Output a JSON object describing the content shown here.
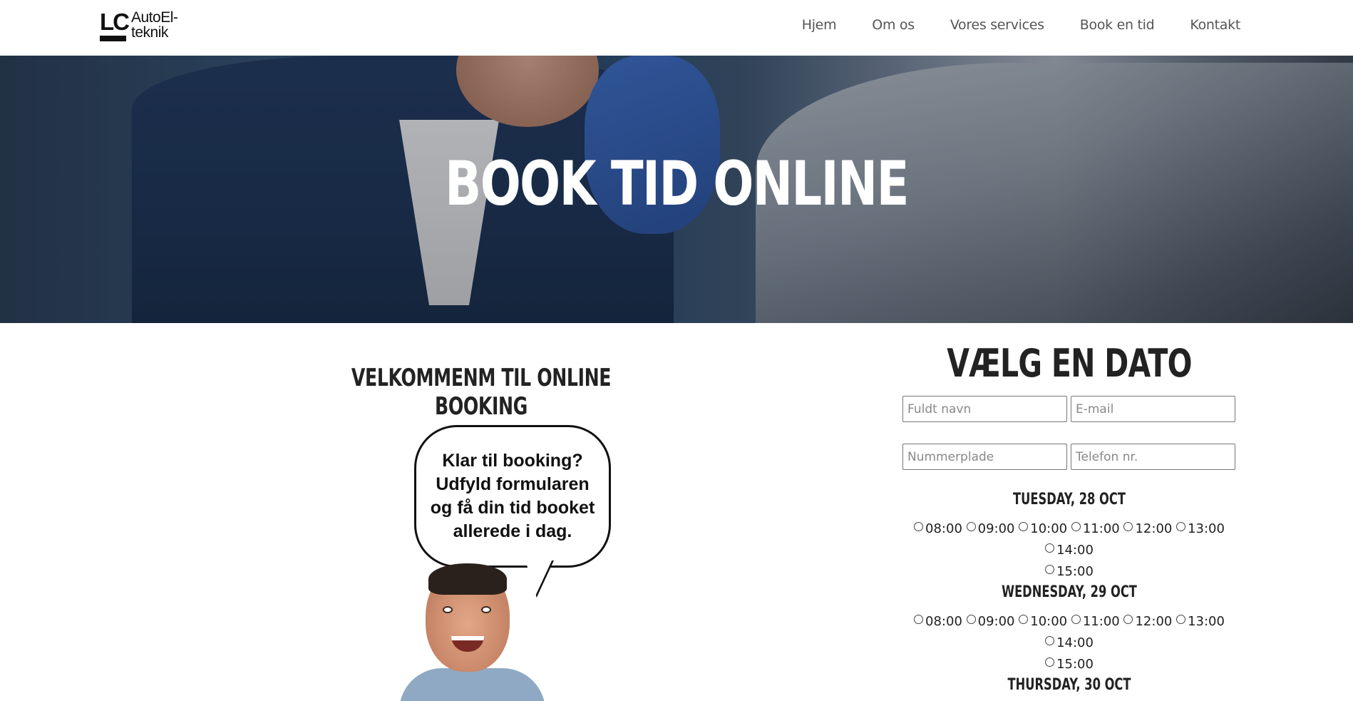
{
  "header": {
    "logo": {
      "mark": "LC",
      "text_line1": "AutoEl-",
      "text_line2": "teknik"
    },
    "nav": [
      {
        "label": "Hjem"
      },
      {
        "label": "Om os"
      },
      {
        "label": "Vores services"
      },
      {
        "label": "Book en tid"
      },
      {
        "label": "Kontakt"
      }
    ]
  },
  "hero": {
    "title": "BOOK TID ONLINE"
  },
  "welcome": {
    "heading": "VELKOMMENM TIL ONLINE BOOKING",
    "bubble_text": "Klar til booking?\nUdfyld formularen\nog få din tid booket\nallerede i dag."
  },
  "booking": {
    "title": "VÆLG EN DATO",
    "fields": {
      "name_placeholder": "Fuldt navn",
      "email_placeholder": "E-mail",
      "plate_placeholder": "Nummerplade",
      "phone_placeholder": "Telefon nr."
    },
    "days": [
      {
        "label": "TUESDAY, 28 OCT",
        "times": [
          "08:00",
          "09:00",
          "10:00",
          "11:00",
          "12:00",
          "13:00",
          "14:00",
          "15:00"
        ]
      },
      {
        "label": "WEDNESDAY, 29 OCT",
        "times": [
          "08:00",
          "09:00",
          "10:00",
          "11:00",
          "12:00",
          "13:00",
          "14:00",
          "15:00"
        ]
      },
      {
        "label": "THURSDAY, 30 OCT",
        "times": []
      }
    ]
  }
}
